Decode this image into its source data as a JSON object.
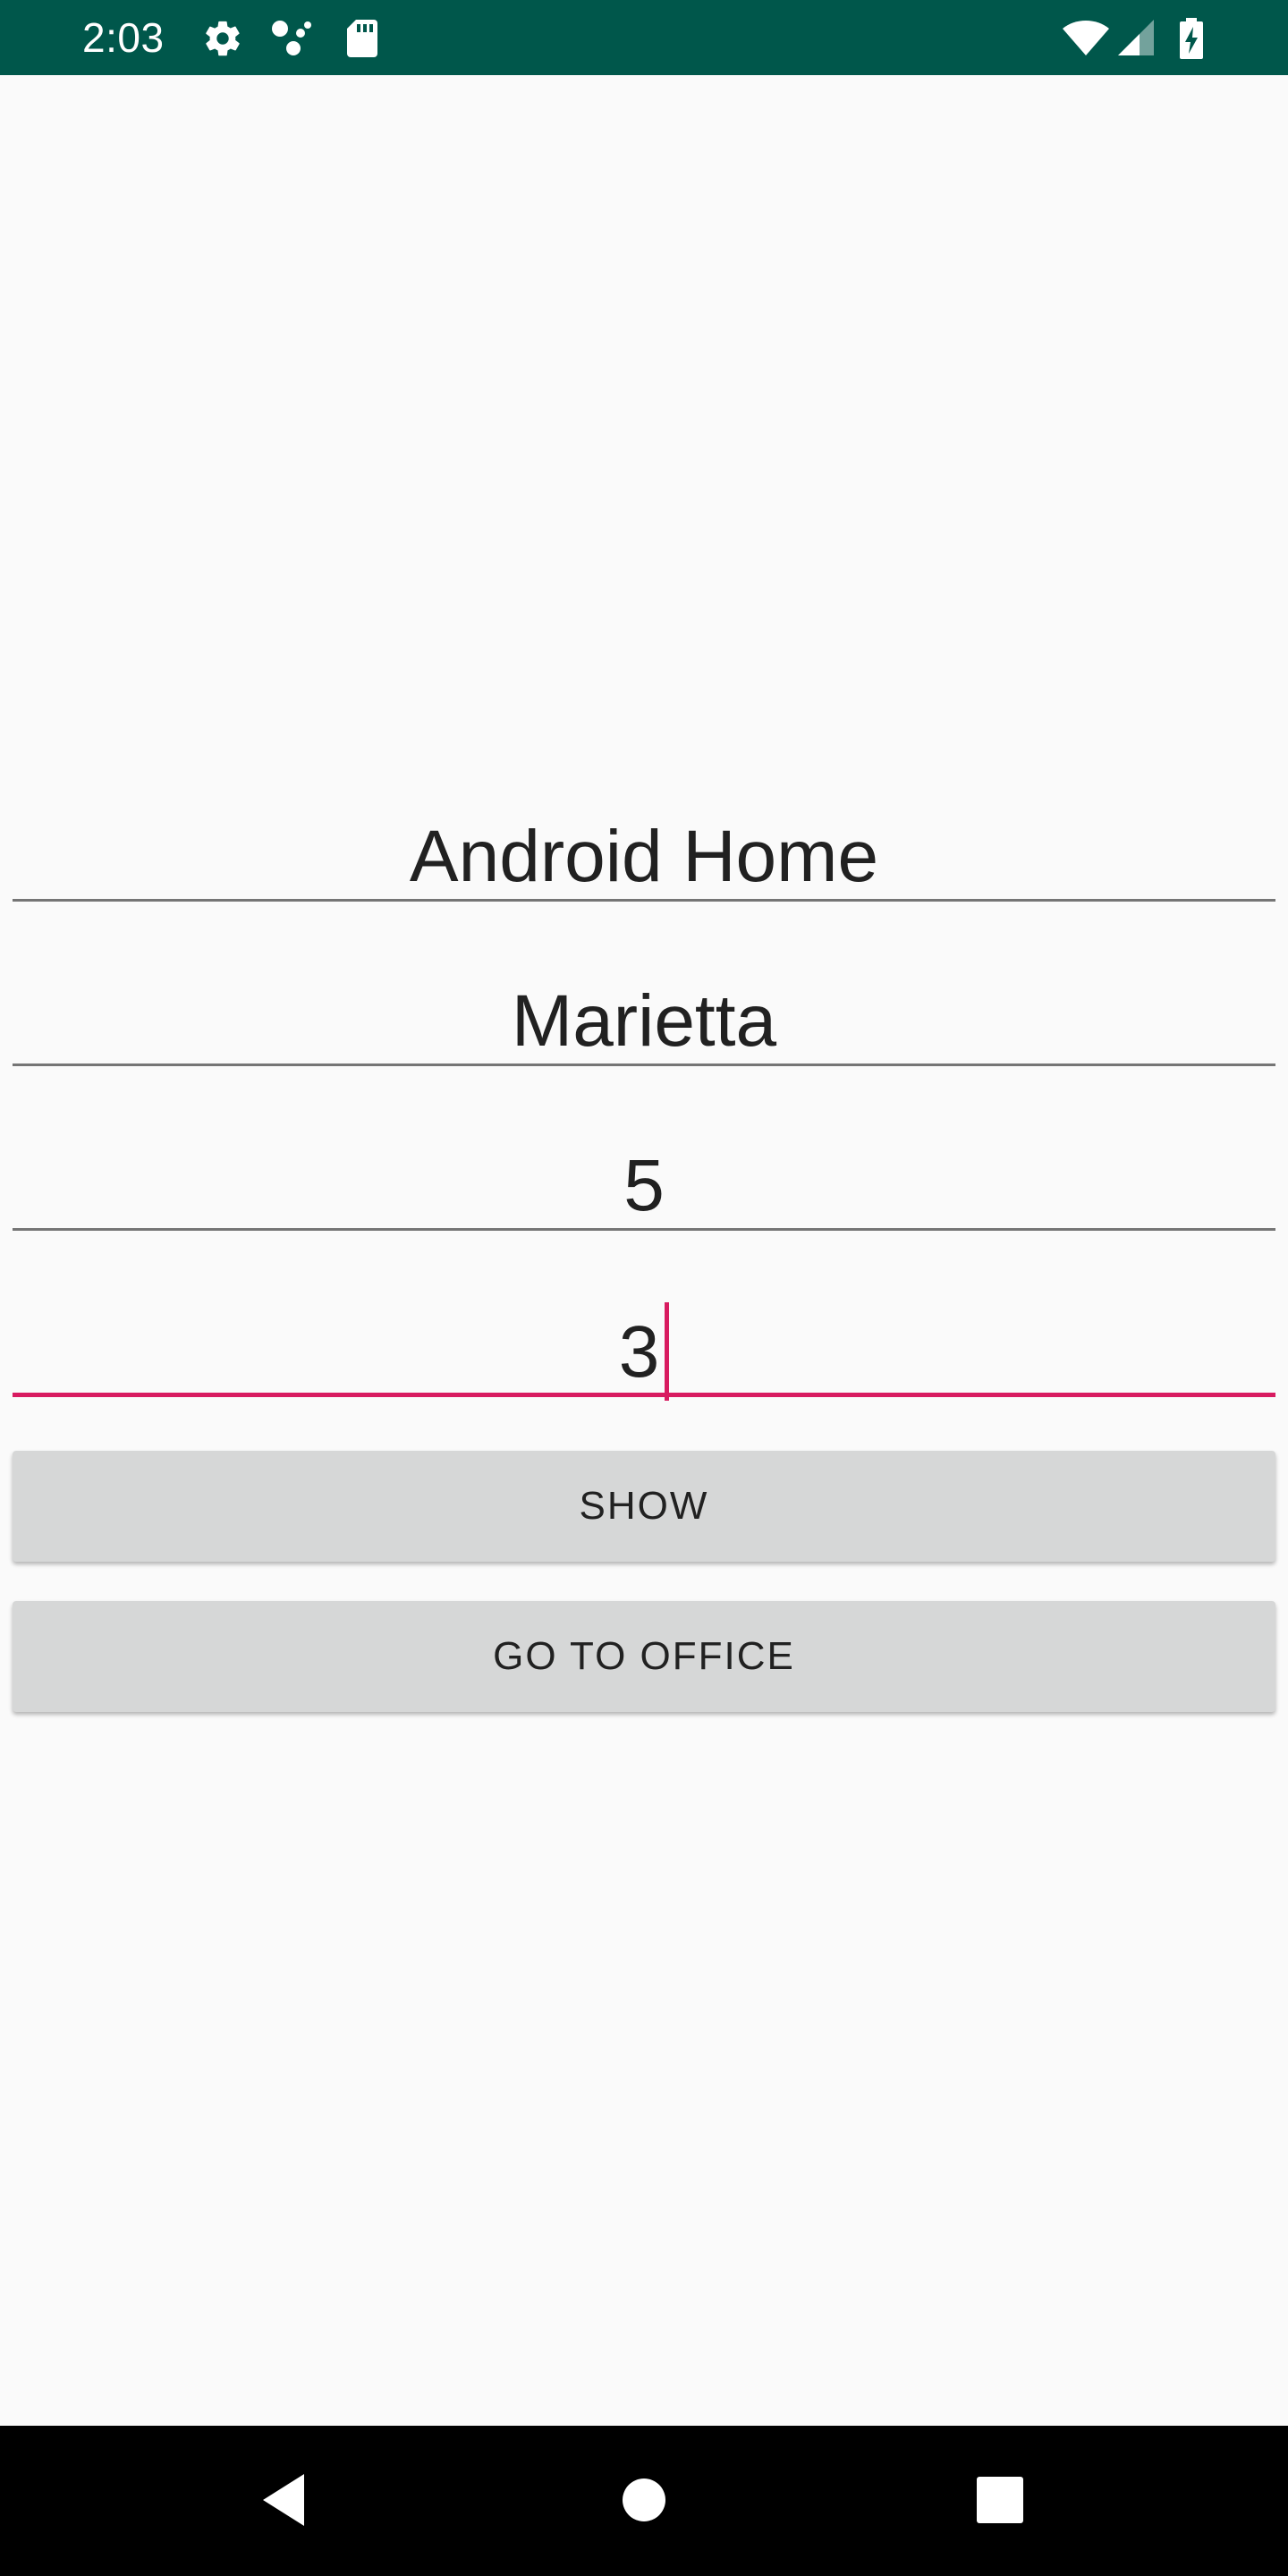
{
  "status_bar": {
    "time": "2:03",
    "background_color": "#00574b",
    "icons": [
      "settings-gear-icon",
      "assistant-dots-icon",
      "sd-card-icon",
      "wifi-icon",
      "cell-signal-icon",
      "battery-charging-icon"
    ]
  },
  "form": {
    "fields": [
      {
        "value": "Android Home",
        "focused": false
      },
      {
        "value": "Marietta",
        "focused": false
      },
      {
        "value": "5",
        "focused": false
      },
      {
        "value": "3",
        "focused": true
      }
    ],
    "accent_color": "#d81b60"
  },
  "buttons": {
    "show_label": "SHOW",
    "office_label": "GO TO OFFICE"
  },
  "nav_bar": {
    "icons": [
      "back-icon",
      "home-icon",
      "recents-icon"
    ]
  }
}
